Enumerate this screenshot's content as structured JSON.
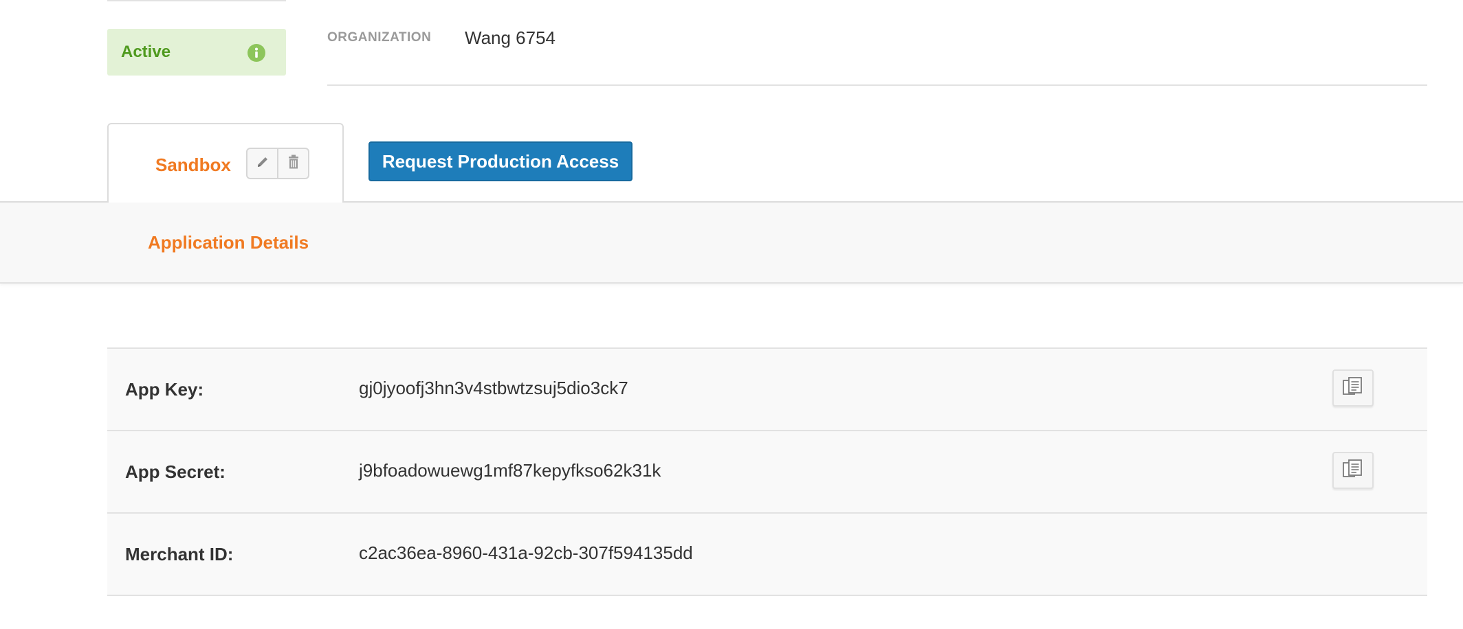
{
  "status": {
    "label": "Active",
    "icon": "info-icon",
    "background_color": "#e3f2d6",
    "text_color": "#4f9a1e"
  },
  "organization": {
    "label": "ORGANIZATION",
    "value": "Wang 6754"
  },
  "tabs": [
    {
      "label": "Sandbox",
      "active": true,
      "actions": [
        {
          "name": "edit",
          "icon": "pencil-icon"
        },
        {
          "name": "delete",
          "icon": "trash-icon"
        }
      ]
    }
  ],
  "request_button": {
    "label": "Request Production Access",
    "color": "#1e7dba"
  },
  "subnav": {
    "active_item": "Application Details"
  },
  "details": {
    "rows": [
      {
        "label": "App Key:",
        "value": "gj0jyoofj3hn3v4stbwtzsuj5dio3ck7",
        "copyable": true
      },
      {
        "label": "App Secret:",
        "value": "j9bfoadowuewg1mf87kepyfkso62k31k",
        "copyable": true
      },
      {
        "label": "Merchant ID:",
        "value": "c2ac36ea-8960-431a-92cb-307f594135dd",
        "copyable": false
      }
    ]
  },
  "colors": {
    "accent": "#f07a22",
    "primary_button": "#1e7dba"
  }
}
